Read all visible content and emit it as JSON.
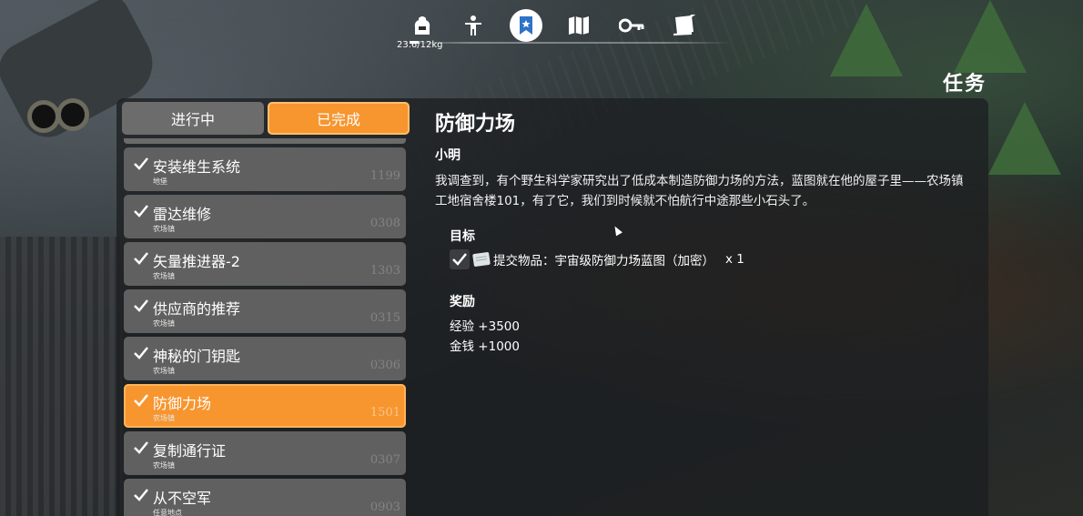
{
  "hud": {
    "weight": "23.6/12kg",
    "nav_icons": [
      "backpack-icon",
      "character-icon",
      "quest-icon",
      "map-icon",
      "key-icon",
      "journal-icon"
    ],
    "active_nav": "quest-icon",
    "screen_title": "任务"
  },
  "tabs": {
    "in_progress": "进行中",
    "completed": "已完成",
    "active": "completed"
  },
  "quests": [
    {
      "name": "安装维生系统",
      "location": "地堡",
      "code": "1199"
    },
    {
      "name": "雷达维修",
      "location": "农场镇",
      "code": "0308"
    },
    {
      "name": "矢量推进器-2",
      "location": "农场镇",
      "code": "1303"
    },
    {
      "name": "供应商的推荐",
      "location": "农场镇",
      "code": "0315"
    },
    {
      "name": "神秘的门钥匙",
      "location": "农场镇",
      "code": "0306"
    },
    {
      "name": "防御力场",
      "location": "农场镇",
      "code": "1501"
    },
    {
      "name": "复制通行证",
      "location": "农场镇",
      "code": "0307"
    },
    {
      "name": "从不空军",
      "location": "任意地点",
      "code": "0903"
    }
  ],
  "selected_index": 5,
  "detail": {
    "title": "防御力场",
    "giver": "小明",
    "description": "我调查到，有个野生科学家研究出了低成本制造防御力场的方法，蓝图就在他的屋子里——农场镇工地宿舍楼101，有了它，我们到时候就不怕航行中途那些小石头了。",
    "objective_label": "目标",
    "objective_text": "提交物品：宇宙级防御力场蓝图（加密）",
    "objective_qty": "x 1",
    "reward_label": "奖励",
    "rewards": [
      "经验 +3500",
      "金钱 +1000"
    ]
  },
  "colors": {
    "accent": "#f7952e",
    "item_bg": "#5f605f",
    "panel_bg": "#1c1f21",
    "active_icon": "#2f73c8"
  }
}
